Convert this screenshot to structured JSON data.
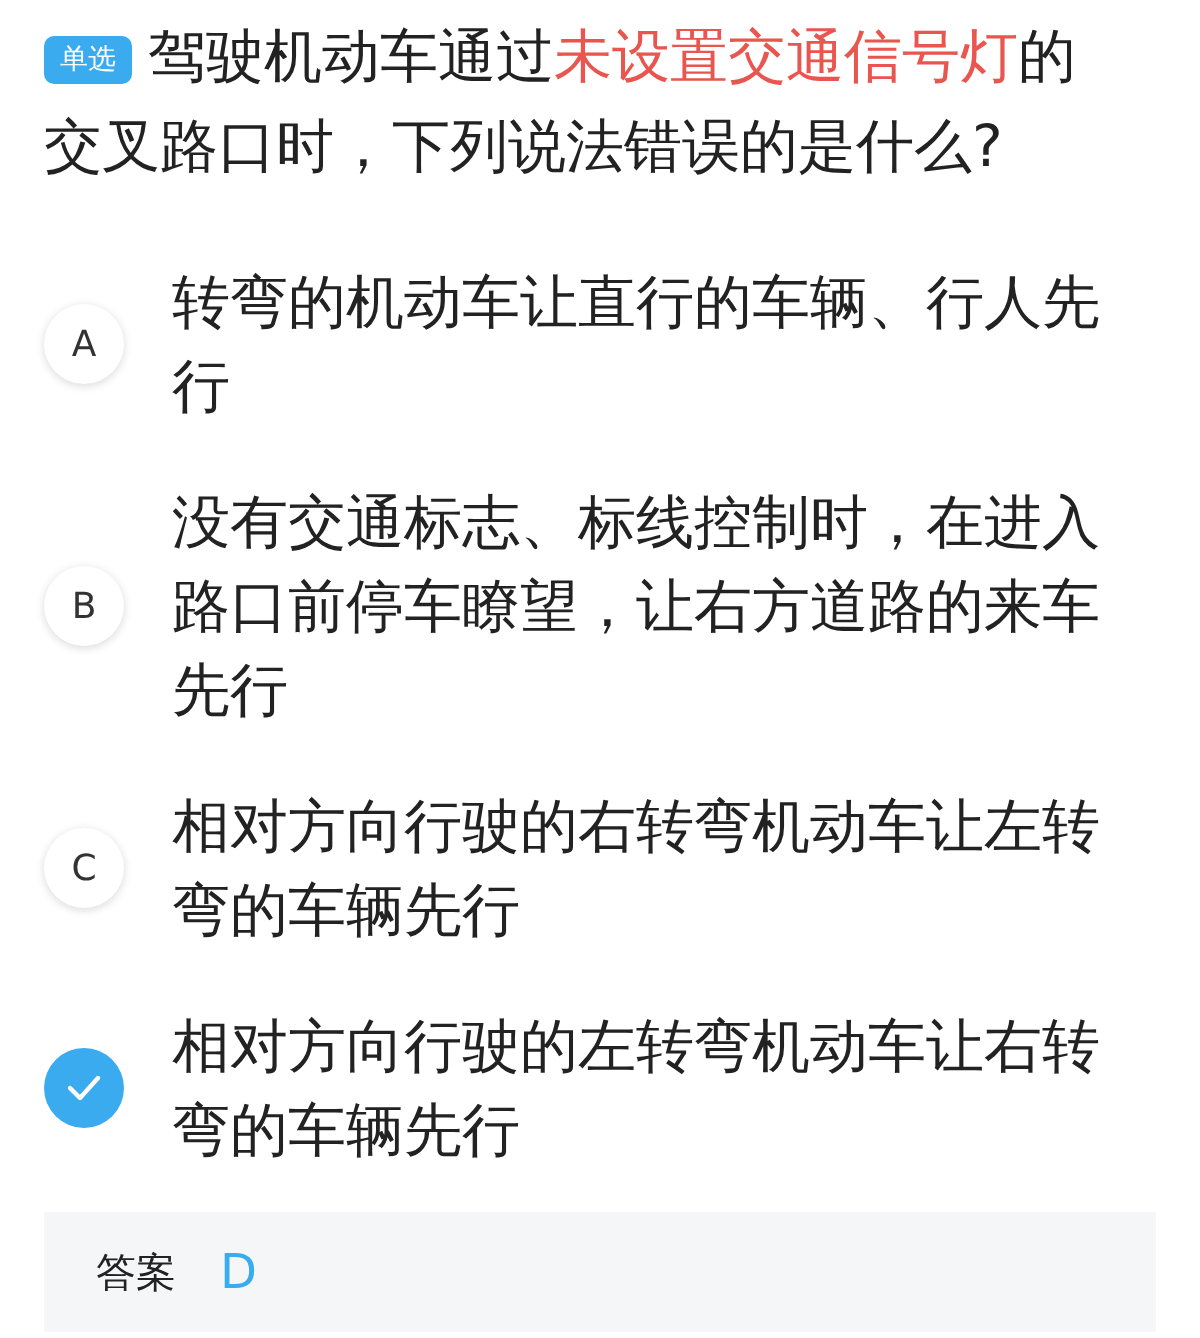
{
  "question": {
    "badge": "单选",
    "parts": [
      {
        "text": "驾驶机动车通过",
        "highlight": false
      },
      {
        "text": "未设置交通信号灯",
        "highlight": true
      },
      {
        "text": "的交叉路口时，下列说法错误的是什么?",
        "highlight": false
      }
    ]
  },
  "options": [
    {
      "letter": "A",
      "text": "转弯的机动车让直行的车辆、行人先行",
      "selected": false
    },
    {
      "letter": "B",
      "text": "没有交通标志、标线控制时，在进入路口前停车瞭望，让右方道路的来车先行",
      "selected": false
    },
    {
      "letter": "C",
      "text": "相对方向行驶的右转弯机动车让左转弯的车辆先行",
      "selected": false
    },
    {
      "text": "相对方向行驶的左转弯机动车让右转弯的车辆先行",
      "selected": true
    }
  ],
  "answer": {
    "label": "答案",
    "value": "D"
  }
}
